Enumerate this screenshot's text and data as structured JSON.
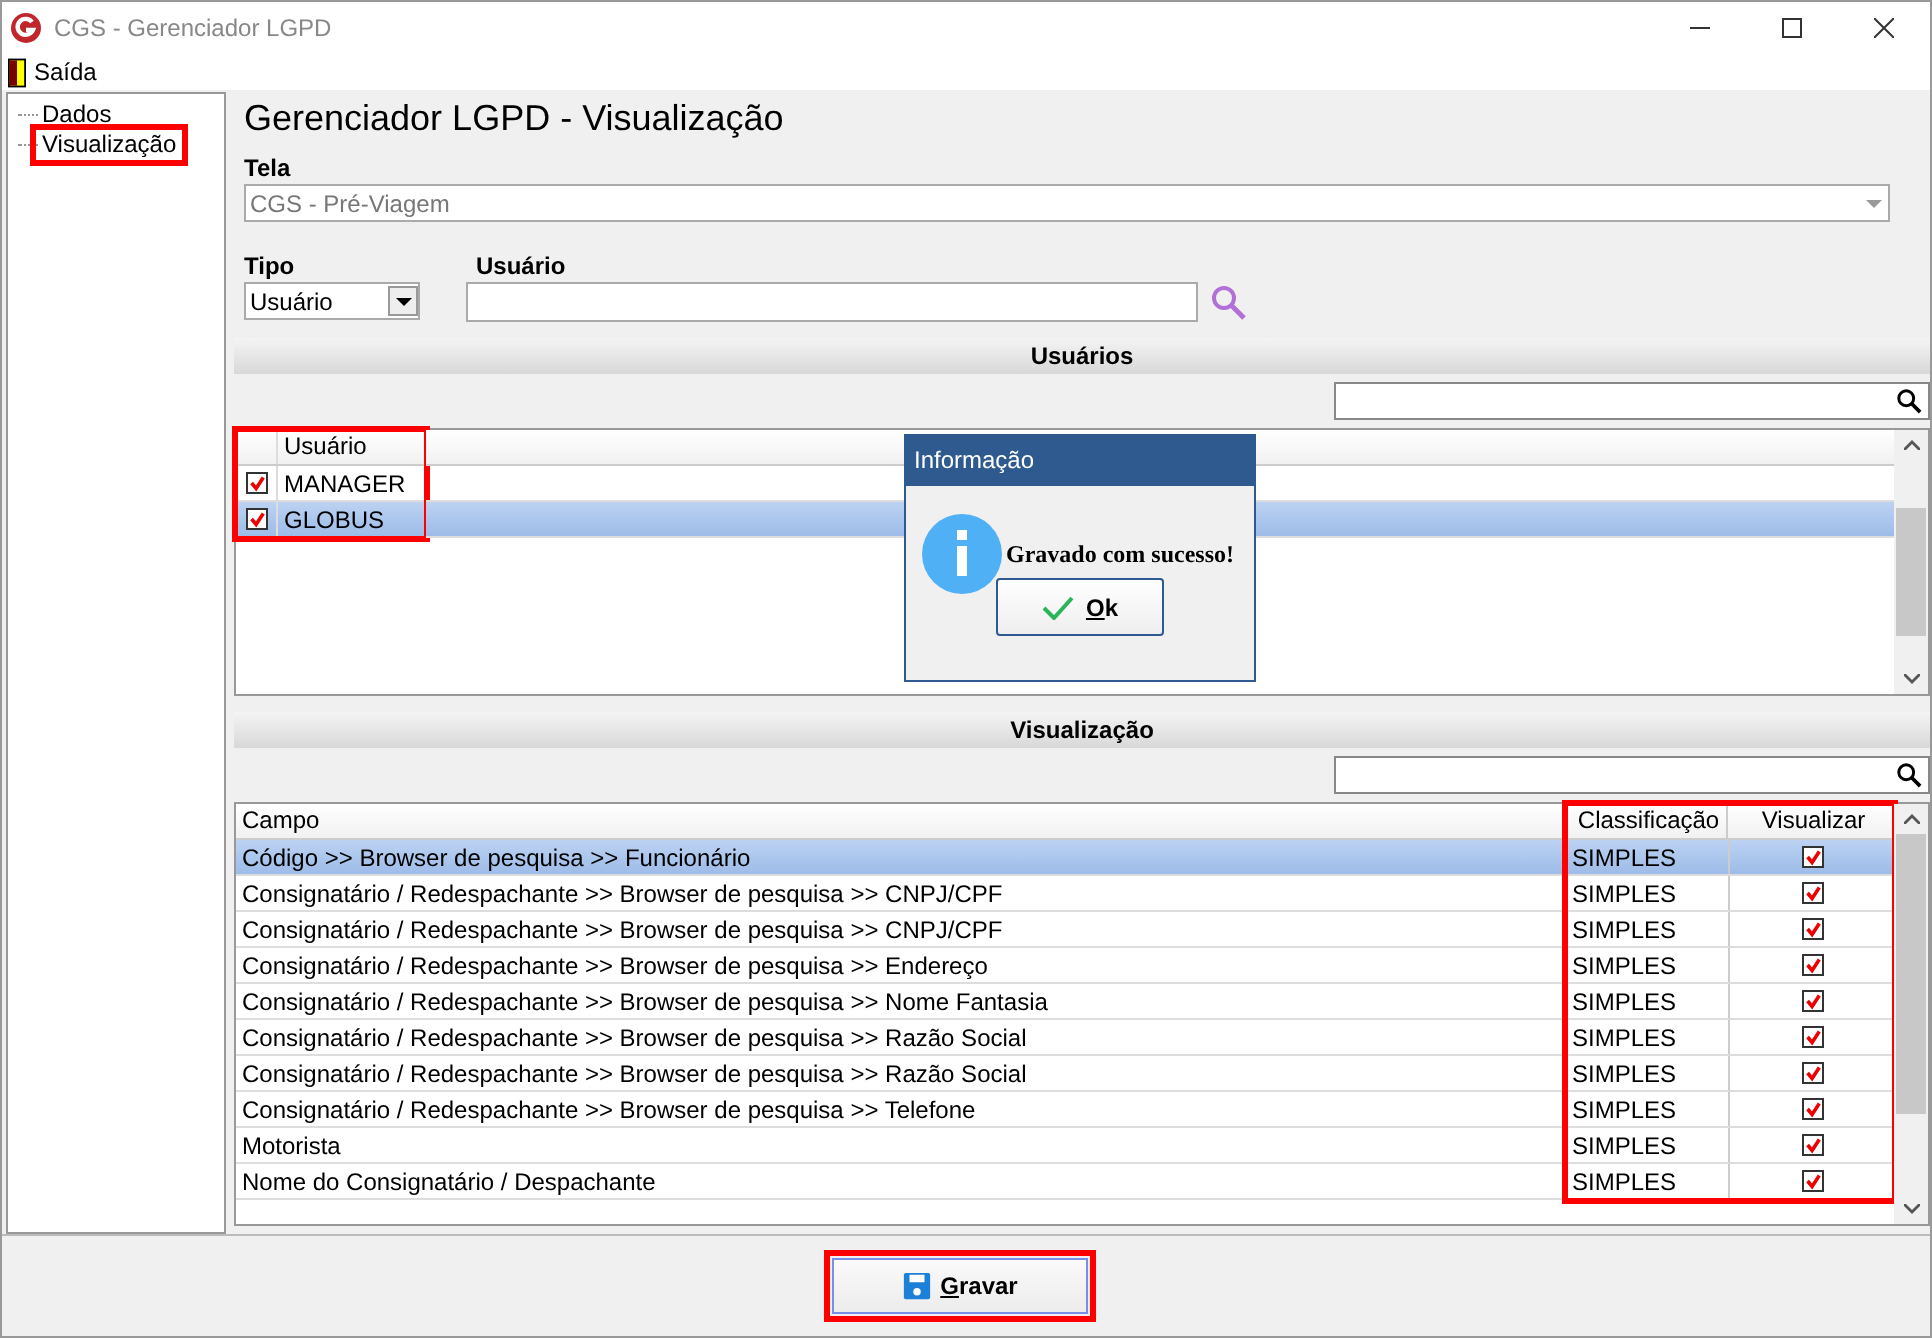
{
  "window": {
    "title": "CGS - Gerenciador LGPD"
  },
  "menu": [
    {
      "label": "Saída"
    }
  ],
  "tree": [
    {
      "label": "Dados",
      "highlighted": false
    },
    {
      "label": "Visualização",
      "highlighted": true
    }
  ],
  "heading": "Gerenciador LGPD - Visualização",
  "tela": {
    "label": "Tela",
    "value": "CGS - Pré-Viagem",
    "disabled": true
  },
  "tipo": {
    "label": "Tipo",
    "value": "Usuário"
  },
  "usuario": {
    "label": "Usuário"
  },
  "users_section": {
    "title": "Usuários",
    "highlighted": true,
    "column": "Usuário",
    "rows": [
      {
        "name": "MANAGER",
        "checked": true,
        "selected": false
      },
      {
        "name": "GLOBUS",
        "checked": true,
        "selected": true
      }
    ]
  },
  "view_section": {
    "title": "Visualização",
    "highlight_right_columns": true,
    "columns": [
      "Campo",
      "Classificação",
      "Visualizar"
    ],
    "rows": [
      {
        "campo": "Código >> Browser de pesquisa >> Funcionário",
        "classificacao": "SIMPLES",
        "visualizar": true,
        "selected": true
      },
      {
        "campo": "Consignatário / Redespachante >> Browser de pesquisa >> CNPJ/CPF",
        "classificacao": "SIMPLES",
        "visualizar": true,
        "selected": false
      },
      {
        "campo": "Consignatário / Redespachante >> Browser de pesquisa >> CNPJ/CPF",
        "classificacao": "SIMPLES",
        "visualizar": true,
        "selected": false
      },
      {
        "campo": "Consignatário / Redespachante >> Browser de pesquisa >> Endereço",
        "classificacao": "SIMPLES",
        "visualizar": true,
        "selected": false
      },
      {
        "campo": "Consignatário / Redespachante >> Browser de pesquisa >> Nome Fantasia",
        "classificacao": "SIMPLES",
        "visualizar": true,
        "selected": false
      },
      {
        "campo": "Consignatário / Redespachante >> Browser de pesquisa >> Razão Social",
        "classificacao": "SIMPLES",
        "visualizar": true,
        "selected": false
      },
      {
        "campo": "Consignatário / Redespachante >> Browser de pesquisa >> Razão Social",
        "classificacao": "SIMPLES",
        "visualizar": true,
        "selected": false
      },
      {
        "campo": "Consignatário / Redespachante >> Browser de pesquisa >> Telefone",
        "classificacao": "SIMPLES",
        "visualizar": true,
        "selected": false
      },
      {
        "campo": "Motorista",
        "classificacao": "SIMPLES",
        "visualizar": true,
        "selected": false
      },
      {
        "campo": "Nome do Consignatário / Despachante",
        "classificacao": "SIMPLES",
        "visualizar": true,
        "selected": false
      }
    ]
  },
  "save_button": {
    "label": "Gravar",
    "highlighted": true
  },
  "dialog": {
    "title": "Informação",
    "message": "Gravado com sucesso!",
    "button": {
      "label": "Ok"
    }
  }
}
